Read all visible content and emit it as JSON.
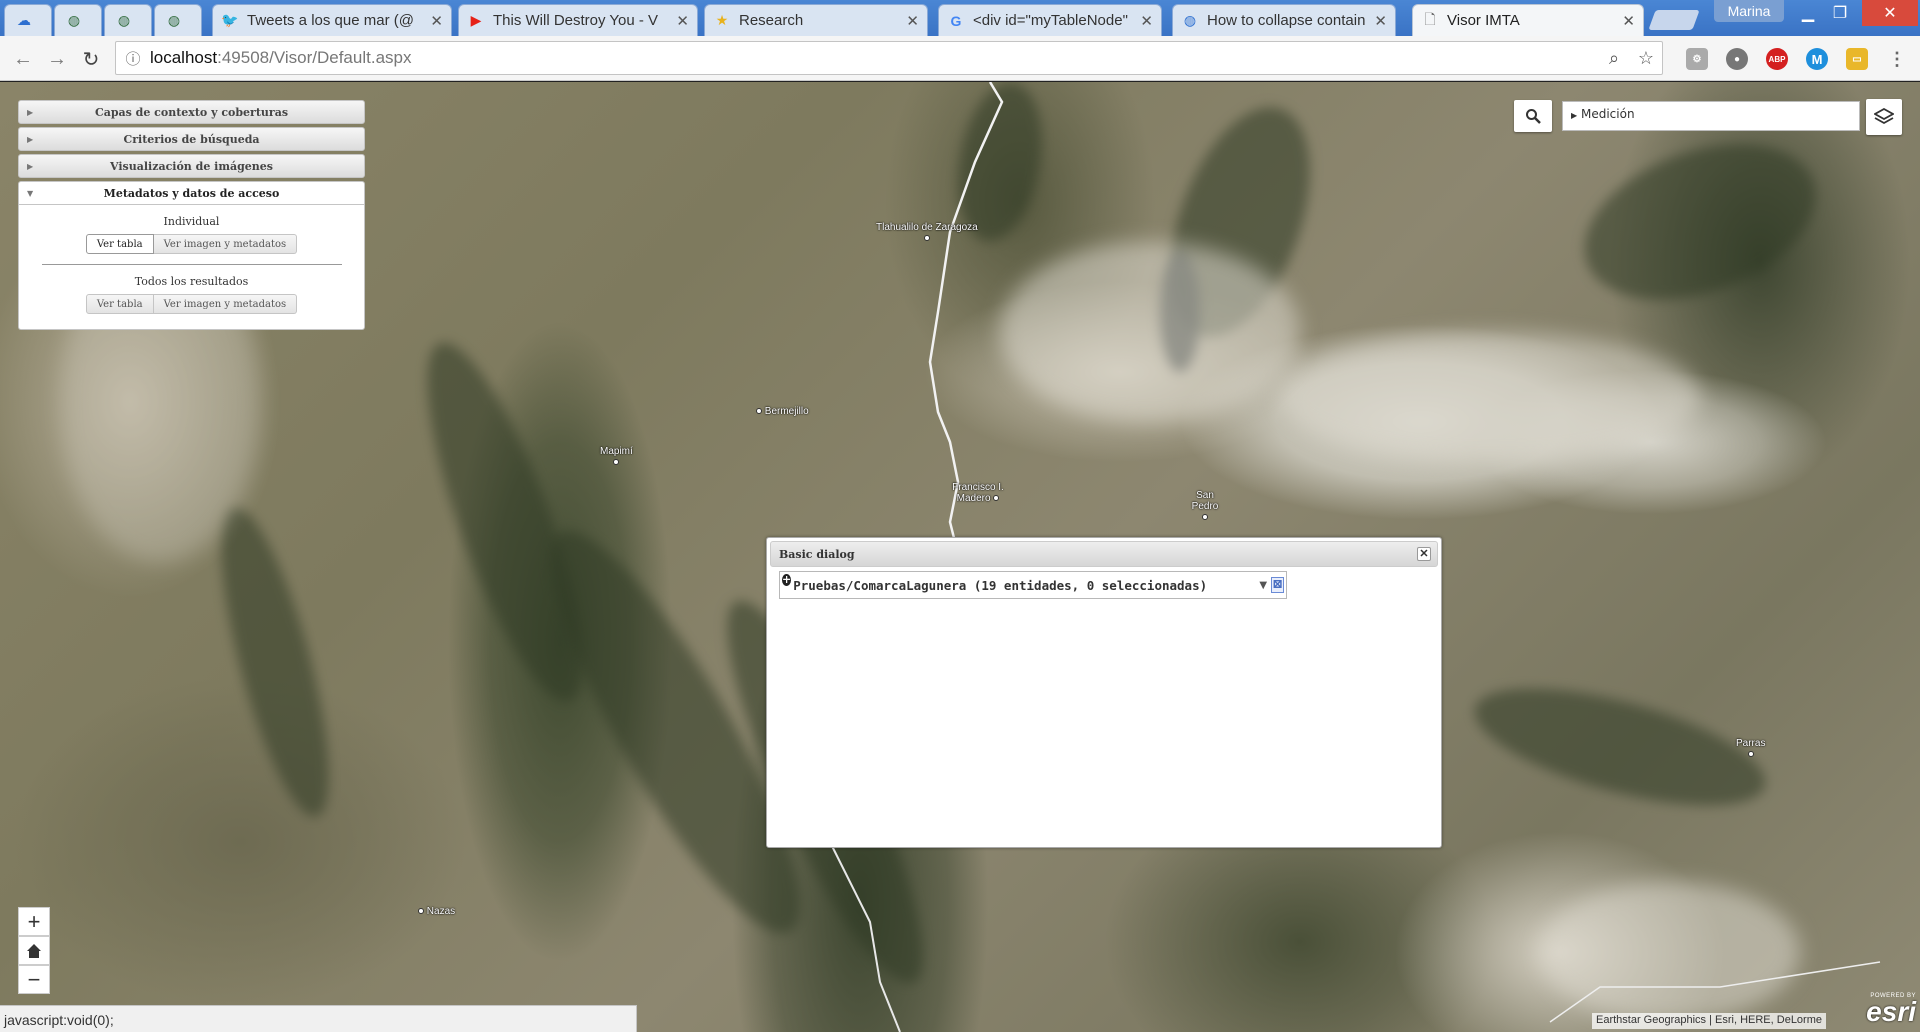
{
  "browser": {
    "tabs": [
      {
        "label": "",
        "icon": "cloud-icon"
      },
      {
        "label": "",
        "icon": "globe-icon"
      },
      {
        "label": "",
        "icon": "globe-icon"
      },
      {
        "label": "",
        "icon": "globe-icon"
      },
      {
        "label": "Tweets a los que mar (@",
        "icon": "twitter-icon"
      },
      {
        "label": "This Will Destroy You - V",
        "icon": "youtube-icon"
      },
      {
        "label": "Research",
        "icon": "star-icon"
      },
      {
        "label": "<div id=\"myTableNode\"",
        "icon": "google-icon"
      },
      {
        "label": "How to collapse contain",
        "icon": "stackoverflow-icon"
      },
      {
        "label": "Visor IMTA",
        "icon": "page-icon"
      }
    ],
    "profile": "Marina",
    "url_host": "localhost",
    "url_path": ":49508/Visor/Default.aspx"
  },
  "accordion": {
    "sections": [
      {
        "label": "Capas de contexto y coberturas"
      },
      {
        "label": "Criterios de búsqueda"
      },
      {
        "label": "Visualización de imágenes"
      },
      {
        "label": "Metadatos y datos de acceso"
      }
    ],
    "individual_label": "Individual",
    "todos_label": "Todos los resultados",
    "ver_tabla": "Ver tabla",
    "ver_imagen": "Ver imagen y metadatos"
  },
  "tools": {
    "medicion": "Medición"
  },
  "map": {
    "places": [
      "Tlahualilo de Zaragoza",
      "Bermejillo",
      "Mapimí",
      "Francisco I. Madero",
      "San Pedro",
      "Parras",
      "Nazas"
    ]
  },
  "dialog": {
    "title": "Basic dialog",
    "row_text": "Pruebas/ComarcaLagunera (19 entidades, 0 seleccionadas)"
  },
  "footer": {
    "status": "javascript:void(0);",
    "attribution": "Earthstar Geographics | Esri, HERE, DeLorme",
    "esri_powered": "POWERED BY",
    "esri_logo": "esri"
  }
}
